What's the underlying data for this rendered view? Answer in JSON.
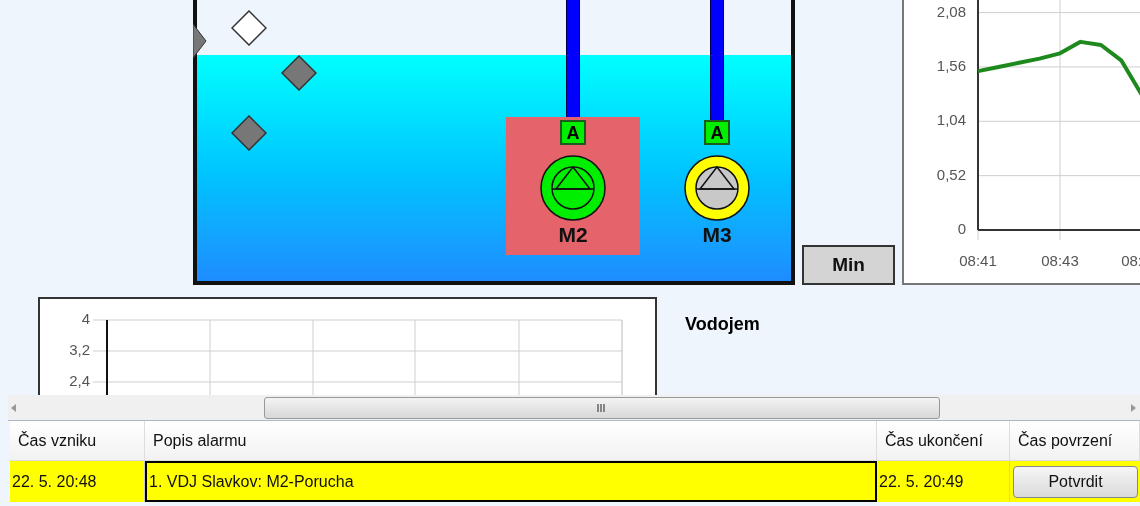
{
  "tank": {
    "sensors": [
      {
        "kind": "marker",
        "filled": true
      },
      {
        "kind": "diamond",
        "filled": false
      },
      {
        "kind": "diamond",
        "filled": true
      },
      {
        "kind": "diamond",
        "filled": true
      }
    ],
    "pumps": [
      {
        "label": "M2",
        "mode": "A",
        "running": true,
        "fault": true
      },
      {
        "label": "M3",
        "mode": "A",
        "running": false,
        "fault": false
      }
    ]
  },
  "min_button": "Min",
  "trend_chart": {
    "chart_data": {
      "type": "line",
      "categories": [
        "08:41",
        null,
        null,
        null,
        "08:43",
        null,
        null,
        null,
        null
      ],
      "grid": true,
      "series": [
        {
          "color": "#1e8a1e",
          "values": [
            1.52,
            1.56,
            1.6,
            1.64,
            1.69,
            1.8,
            1.77,
            1.62,
            1.29
          ]
        }
      ],
      "ylim": [
        0,
        2.08
      ],
      "yticks": [
        {
          "value": 0,
          "label": "0"
        },
        {
          "value": 0.52,
          "label": "0,52"
        },
        {
          "value": 1.04,
          "label": "1,04"
        },
        {
          "value": 1.56,
          "label": "1,56"
        },
        {
          "value": 2.08,
          "label": "2,08"
        }
      ]
    },
    "edge_label": "08:"
  },
  "lower_chart": {
    "y_labels": [
      "4",
      "3,2",
      "2,4"
    ]
  },
  "title": "Vodojem",
  "alarm_table": {
    "columns": [
      "Čas vzniku",
      "Popis alarmu",
      "Čas ukončení",
      "Čas povrzení"
    ],
    "rows": [
      {
        "selected": true,
        "cells": [
          {
            "text": "22. 5. 20:48",
            "focused": false
          },
          {
            "text": "1. VDJ Slavkov: M2-Porucha",
            "focused": true
          },
          {
            "text": "22. 5. 20:49",
            "focused": false
          }
        ],
        "button": "Potvrdit"
      }
    ]
  }
}
